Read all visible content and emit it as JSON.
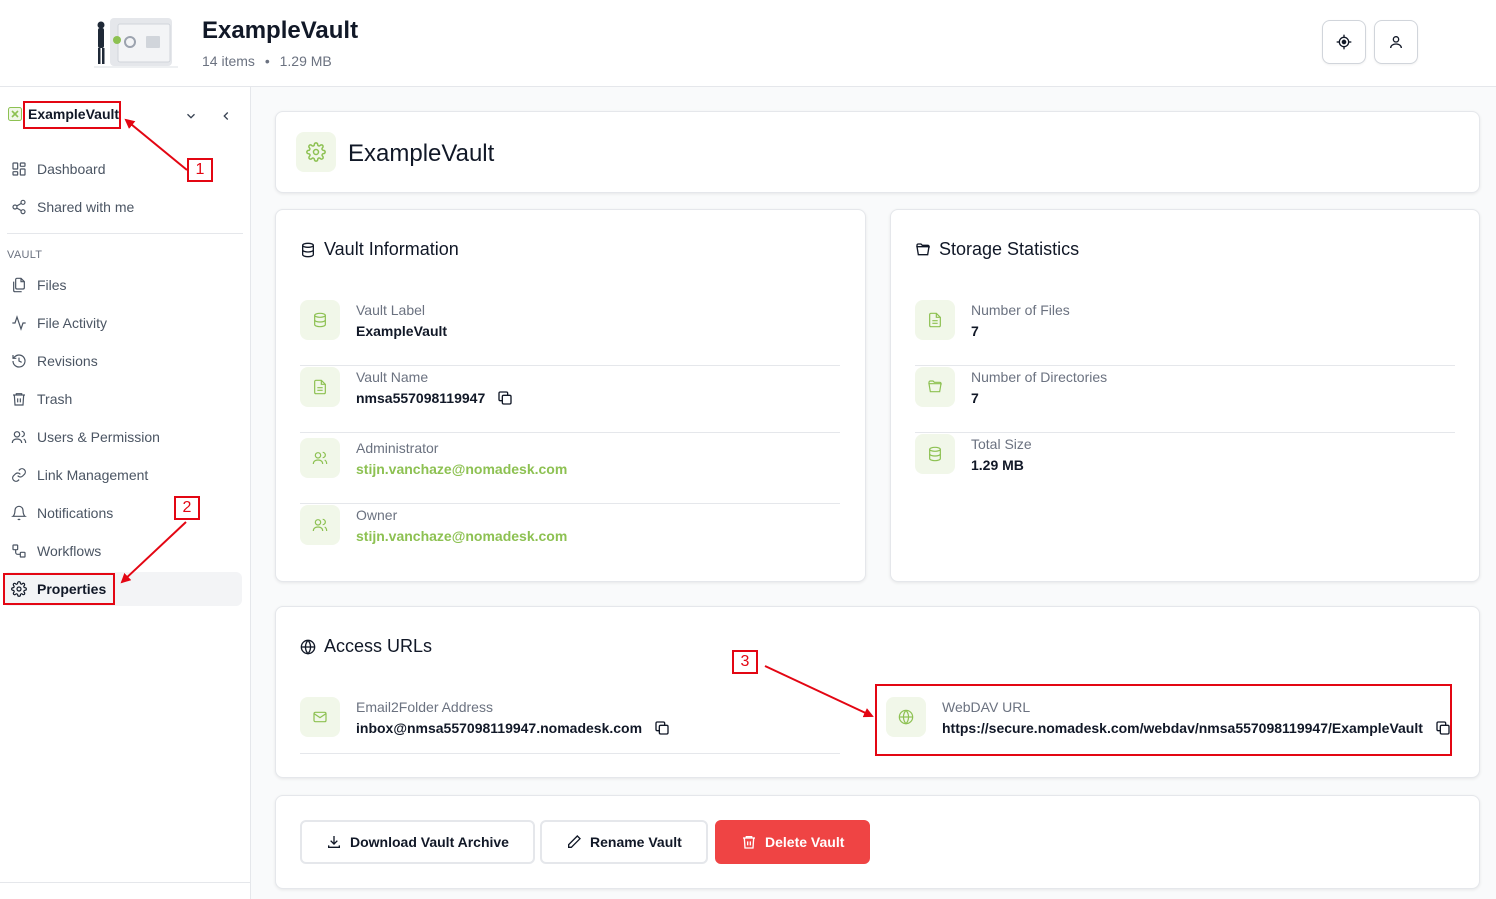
{
  "header": {
    "title": "ExampleVault",
    "item_count": "14 items",
    "separator": "•",
    "size": "1.29 MB"
  },
  "sidebar": {
    "vault_selector": "ExampleVault",
    "section_vault": "VAULT",
    "top_items": [
      {
        "label": "Dashboard",
        "icon": "dashboard-icon"
      },
      {
        "label": "Shared with me",
        "icon": "share-icon"
      }
    ],
    "vault_items": [
      {
        "label": "Files",
        "icon": "files-icon"
      },
      {
        "label": "File Activity",
        "icon": "activity-icon"
      },
      {
        "label": "Revisions",
        "icon": "history-icon"
      },
      {
        "label": "Trash",
        "icon": "trash-icon"
      },
      {
        "label": "Users & Permission",
        "icon": "users-icon"
      },
      {
        "label": "Link Management",
        "icon": "link-icon"
      },
      {
        "label": "Notifications",
        "icon": "bell-icon"
      },
      {
        "label": "Workflows",
        "icon": "workflow-icon"
      },
      {
        "label": "Properties",
        "icon": "gear-icon",
        "active": true
      }
    ]
  },
  "page": {
    "title": "ExampleVault"
  },
  "vault_info": {
    "title": "Vault Information",
    "rows": [
      {
        "label": "Vault Label",
        "value": "ExampleVault",
        "icon": "database-icon"
      },
      {
        "label": "Vault Name",
        "value": "nmsa557098119947",
        "icon": "file-icon",
        "copyable": true
      },
      {
        "label": "Administrator",
        "value": "stijn.vanchaze@nomadesk.com",
        "icon": "users-icon",
        "link": true
      },
      {
        "label": "Owner",
        "value": "stijn.vanchaze@nomadesk.com",
        "icon": "users-icon",
        "link": true
      }
    ]
  },
  "storage_stats": {
    "title": "Storage Statistics",
    "rows": [
      {
        "label": "Number of Files",
        "value": "7",
        "icon": "file-icon"
      },
      {
        "label": "Number of Directories",
        "value": "7",
        "icon": "folder-icon"
      },
      {
        "label": "Total Size",
        "value": "1.29 MB",
        "icon": "database-icon"
      }
    ]
  },
  "access_urls": {
    "title": "Access URLs",
    "email": {
      "label": "Email2Folder Address",
      "value": "inbox@nmsa557098119947.nomadesk.com",
      "icon": "mail-icon"
    },
    "webdav": {
      "label": "WebDAV URL",
      "value": "https://secure.nomadesk.com/webdav/nmsa557098119947/ExampleVault",
      "icon": "globe-icon"
    }
  },
  "actions": {
    "download": "Download Vault Archive",
    "rename": "Rename Vault",
    "delete": "Delete Vault"
  },
  "annotations": {
    "one": "1",
    "two": "2",
    "three": "3"
  },
  "colors": {
    "accent": "#8dc152",
    "accent_bg": "#f1f7e9",
    "danger": "#ef4444",
    "annotation": "#e30613"
  }
}
